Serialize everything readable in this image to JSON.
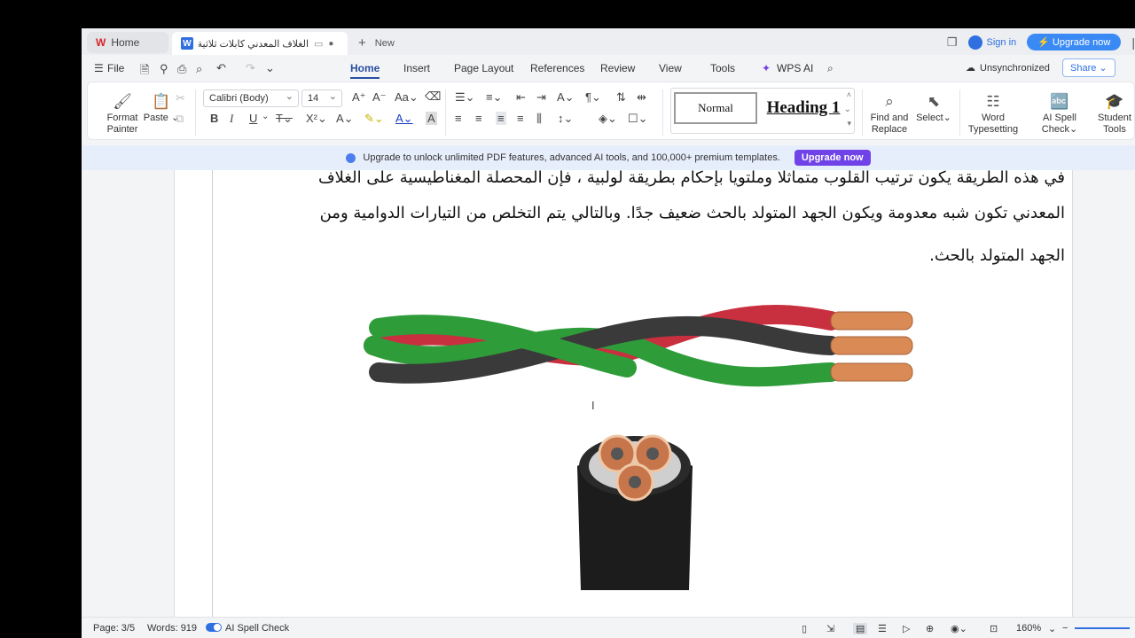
{
  "tabs": {
    "home_label": "Home",
    "doc_title": "الغلاف المعدني كابلات ثلاثية القلب",
    "new_label": "New"
  },
  "account": {
    "sign_in": "Sign in",
    "upgrade": "Upgrade now"
  },
  "menu": {
    "file": "File",
    "items": [
      "Home",
      "Insert",
      "Page Layout",
      "References",
      "Review",
      "View",
      "Tools",
      "WPS AI"
    ],
    "sync_status": "Unsynchronized",
    "share": "Share"
  },
  "ribbon": {
    "format_painter": "Format Painter",
    "paste": "Paste",
    "font_name": "Calibri (Body)",
    "font_size": "14",
    "style_normal": "Normal",
    "style_heading1": "Heading 1",
    "find_replace": "Find and Replace",
    "select": "Select",
    "word_typesetting": "Word Typesetting",
    "ai_spell_check": "AI Spell Check",
    "student_tools": "Student Tools",
    "bold": "B",
    "italic": "I",
    "underline": "U"
  },
  "banner": {
    "text": "Upgrade to unlock unlimited PDF features, advanced AI tools, and 100,000+ premium templates.",
    "button": "Upgrade now"
  },
  "document": {
    "line1": "في هذه الطريقة يكون ترتيب القلوب متماثلا وملتويا بإحكام بطريقة لولبية ، فإن المحصلة المغناطيسية على الغلاف",
    "line2": "المعدني تكون شبه معدومة ويكون الجهد المتولد بالحث ضعيف جدًا. وبالتالي يتم التخلص من التيارات الدوامية ومن",
    "line3": "الجهد المتولد بالحث."
  },
  "status": {
    "page": "Page: 3/5",
    "words": "Words: 919",
    "spell": "AI Spell Check",
    "zoom": "160%"
  },
  "colors": {
    "accent": "#2f6fe0",
    "upgrade_purple": "#6f43e8",
    "cable_red": "#d63447",
    "cable_green": "#2fa43a",
    "cable_black": "#333333",
    "copper": "#d98a55"
  }
}
